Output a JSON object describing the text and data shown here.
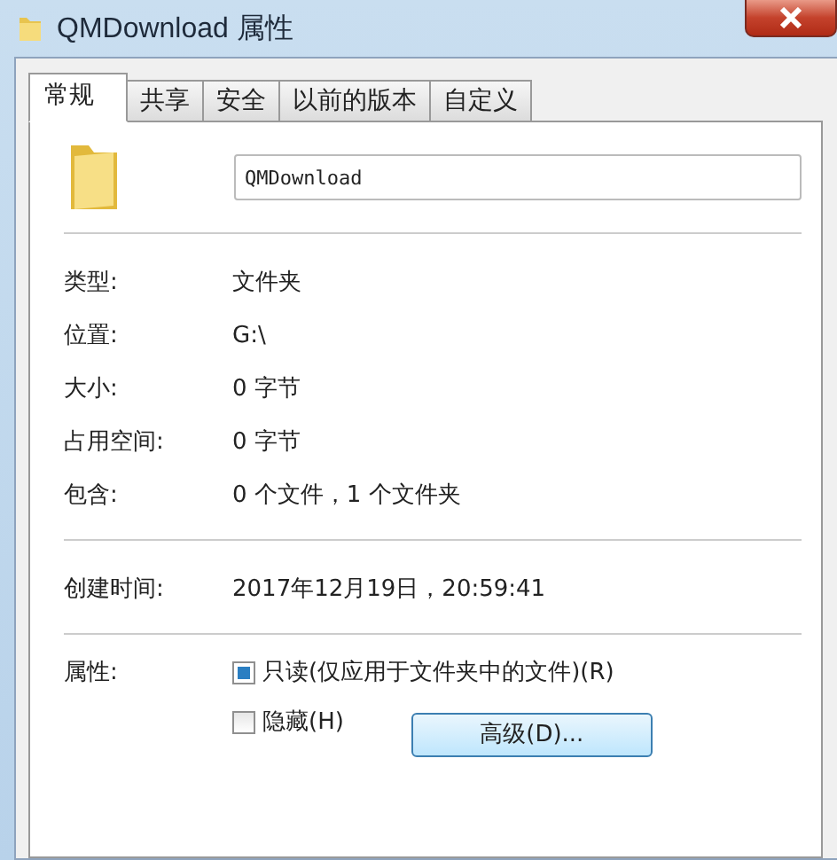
{
  "window": {
    "title": "QMDownload 属性"
  },
  "tabs": [
    {
      "label": "常规",
      "selected": true
    },
    {
      "label": "共享",
      "selected": false
    },
    {
      "label": "安全",
      "selected": false
    },
    {
      "label": "以前的版本",
      "selected": false
    },
    {
      "label": "自定义",
      "selected": false
    }
  ],
  "name_field": {
    "value": "QMDownload"
  },
  "groups": [
    [
      {
        "label": "类型:",
        "value": "文件夹"
      },
      {
        "label": "位置:",
        "value": "G:\\"
      },
      {
        "label": "大小:",
        "value": "0 字节"
      },
      {
        "label": "占用空间:",
        "value": "0 字节"
      },
      {
        "label": "包含:",
        "value": "0 个文件，1 个文件夹"
      }
    ],
    [
      {
        "label": "创建时间:",
        "value": "2017年12月19日，20:59:41"
      }
    ]
  ],
  "attributes": {
    "label": "属性:",
    "options": [
      {
        "label": "只读(仅应用于文件夹中的文件)(R)",
        "checked": false,
        "indeterminate": true
      },
      {
        "label": "隐藏(H)",
        "checked": false,
        "indeterminate": false
      }
    ],
    "button": "高级(D)..."
  }
}
